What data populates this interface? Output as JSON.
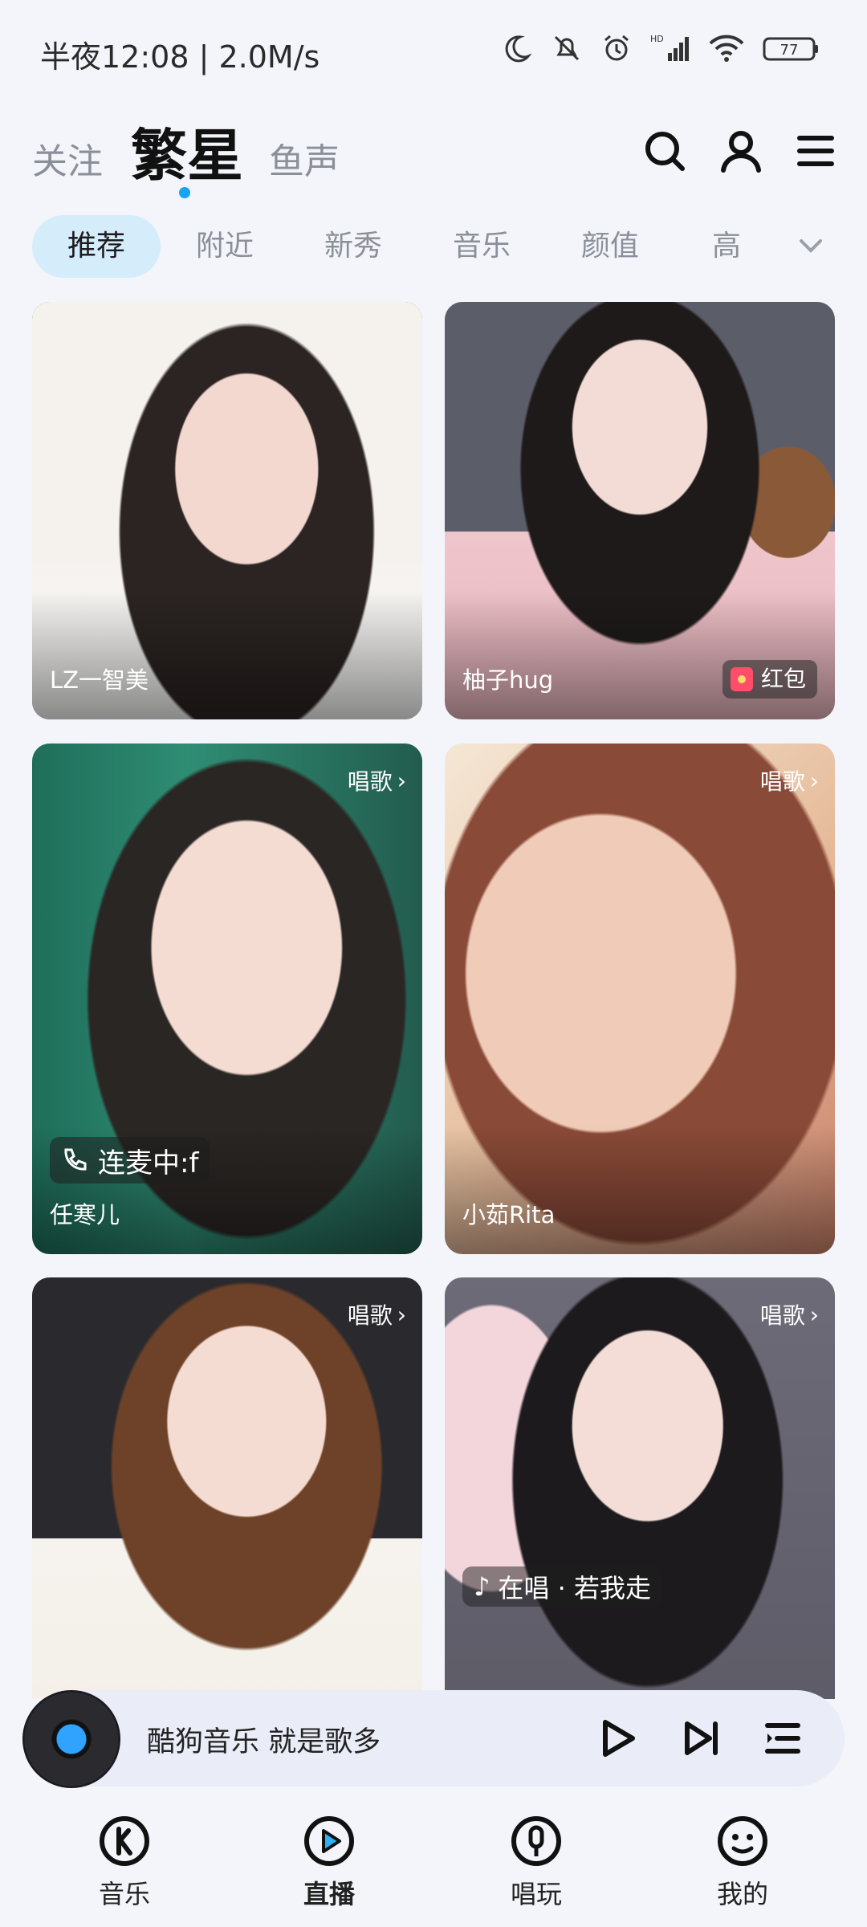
{
  "status": {
    "time": "半夜12:08 | 2.0M/s",
    "battery": "77"
  },
  "header": {
    "tabs": [
      {
        "label": "关注"
      },
      {
        "label": "繁星"
      },
      {
        "label": "鱼声"
      }
    ]
  },
  "categories": [
    "推荐",
    "附近",
    "新秀",
    "音乐",
    "颜值",
    "高"
  ],
  "cards": [
    {
      "name": "LZ一智美"
    },
    {
      "name": "柚子hug",
      "badge": "红包"
    },
    {
      "name": "任寒儿",
      "tag": "唱歌",
      "link_badge": "连麦中:f"
    },
    {
      "name": "小茹Rita",
      "tag": "唱歌"
    },
    {
      "tag": "唱歌"
    },
    {
      "tag": "唱歌",
      "sing_badge": "在唱 · 若我走"
    }
  ],
  "player": {
    "title": "酷狗音乐  就是歌多"
  },
  "bottom_nav": [
    {
      "label": "音乐"
    },
    {
      "label": "直播"
    },
    {
      "label": "唱玩"
    },
    {
      "label": "我的"
    }
  ],
  "colors": {
    "accent": "#1aa3f0",
    "chip_active_bg": "#d5ecfb",
    "background": "#f4f5fa"
  }
}
